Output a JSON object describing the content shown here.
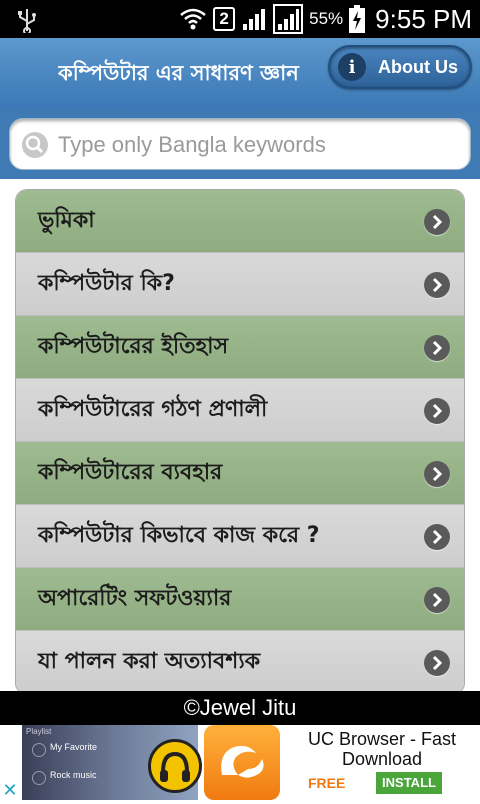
{
  "status_bar": {
    "sim_number": "2",
    "battery_percent": "55%",
    "time": "9:55 PM",
    "icons": [
      "usb-icon",
      "wifi-icon",
      "signal-icon",
      "battery-charging-icon"
    ]
  },
  "header": {
    "title": "কম্পিউটার এর সাধারণ জ্ঞান",
    "about_label": "About Us",
    "about_icon": "info-icon"
  },
  "search": {
    "placeholder": "Type only Bangla keywords",
    "value": "",
    "icon": "search-icon"
  },
  "menu": {
    "items": [
      {
        "label": "ভুমিকা"
      },
      {
        "label": "কম্পিউটার কি?"
      },
      {
        "label": "কম্পিউটারের ইতিহাস"
      },
      {
        "label": "কম্পিউটারের গঠণ প্রণালী"
      },
      {
        "label": "কম্পিউটারের ব্যবহার"
      },
      {
        "label": "কম্পিউটার কিভাবে কাজ করে ?"
      },
      {
        "label": "অপারেটিং সফটওয়্যার"
      },
      {
        "label": "যা পালন করা অত্যাবশ্যক"
      }
    ],
    "item_icon": "chevron-right-circle-icon"
  },
  "footer": {
    "credit": "©Jewel Jitu"
  },
  "ad": {
    "thumb_playlist": "Playlist",
    "thumb_item1": "My Favorite",
    "thumb_item2": "Rock music",
    "title": "UC Browser - Fast Download",
    "free_label": "FREE",
    "install_label": "INSTALL",
    "close_icon": "adchoices-close-icon",
    "colors": {
      "free": "#f07a10",
      "install": "#4aa53a"
    }
  },
  "colors": {
    "header": "#4a88c2",
    "item_green": "#93b085",
    "item_gray": "#d3d3d3"
  }
}
